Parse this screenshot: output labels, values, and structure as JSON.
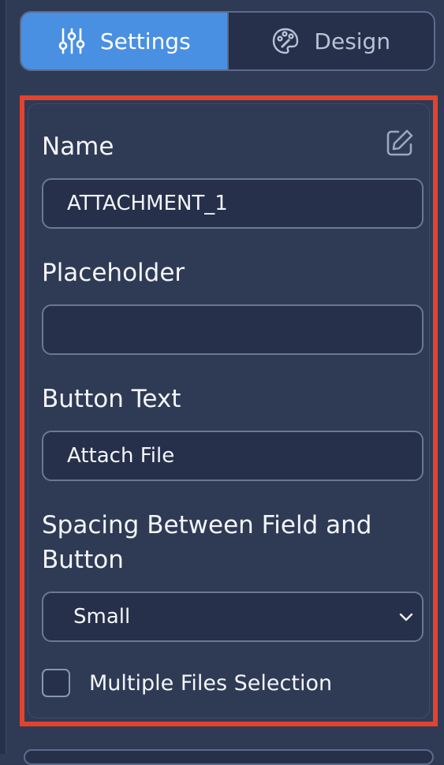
{
  "tabs": [
    {
      "label": "Settings",
      "icon": "sliders-icon",
      "active": true
    },
    {
      "label": "Design",
      "icon": "palette-icon",
      "active": false
    }
  ],
  "fields": {
    "name": {
      "label": "Name",
      "value": "ATTACHMENT_1"
    },
    "placeholder": {
      "label": "Placeholder",
      "value": ""
    },
    "button_text": {
      "label": "Button Text",
      "value": "Attach File"
    },
    "spacing": {
      "label_line1": "Spacing Between Field and",
      "label_line2": "Button",
      "selected": "Small"
    }
  },
  "multiple_files": {
    "label": "Multiple Files Selection",
    "checked": false
  },
  "colors": {
    "accent": "#4a90e2",
    "highlight_border": "#e2432e",
    "panel_bg": "#2f3b55",
    "input_bg": "#26304a"
  }
}
